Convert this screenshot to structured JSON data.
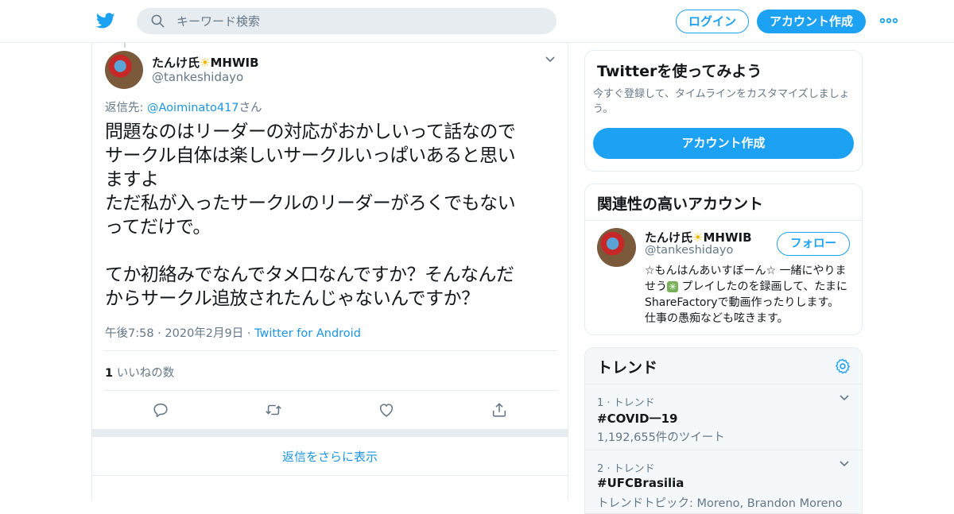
{
  "header": {
    "search_placeholder": "キーワード検索",
    "login_label": "ログイン",
    "signup_label": "アカウント作成",
    "brand_color": "#1da1f2"
  },
  "tweet": {
    "display_name": "たんけ氏",
    "name_emoji": "☀",
    "name_suffix": "MHWIB",
    "handle": "@tankeshidayo",
    "reply_prefix": "返信先:",
    "reply_to": "@Aoiminato417",
    "reply_suffix": "さん",
    "text": "問題なのはリーダーの対応がおかしいって話なので\nサークル自体は楽しいサークルいっぱいあると思い\nますよ\nただ私が入ったサークルのリーダーがろくでもない\nってだけで。\n\nてか初絡みでなんでタメ口なんですか？そんなんだ\nからサークル追放されたんじゃないんですか？",
    "timestamp": "午後7:58 · 2020年2月9日",
    "dot": "·",
    "source": "Twitter for Android",
    "likes_count": "1",
    "likes_label": "いいねの数",
    "show_more_replies": "返信をさらに表示"
  },
  "sidebar": {
    "signup_card": {
      "title": "Twitterを使ってみよう",
      "text": "今すぐ登録して、タイムラインをカスタマイズしましょう。",
      "button": "アカウント作成"
    },
    "related": {
      "title": "関連性の高いアカウント",
      "name": "たんけ氏",
      "name_emoji": "☀",
      "name_suffix": "MHWIB",
      "handle": "@tankeshidayo",
      "follow_label": "フォロー",
      "bio_part1": "☆もんはんあいすぼーん☆ 一緒にやりませう",
      "bio_emoji": "✳",
      "bio_part2": " プレイしたのを録画して、たまにShareFactoryで動画作ったりします。 仕事の愚痴なども呟きます。"
    },
    "trends": {
      "title": "トレンド",
      "items": [
        {
          "rank": "1 · トレンド",
          "name": "#COVID一19",
          "sub": "1,192,655件のツイート"
        },
        {
          "rank": "2 · トレンド",
          "name": "#UFCBrasilia",
          "sub": "トレンドトピック: Moreno, Brandon Moreno"
        }
      ]
    }
  }
}
